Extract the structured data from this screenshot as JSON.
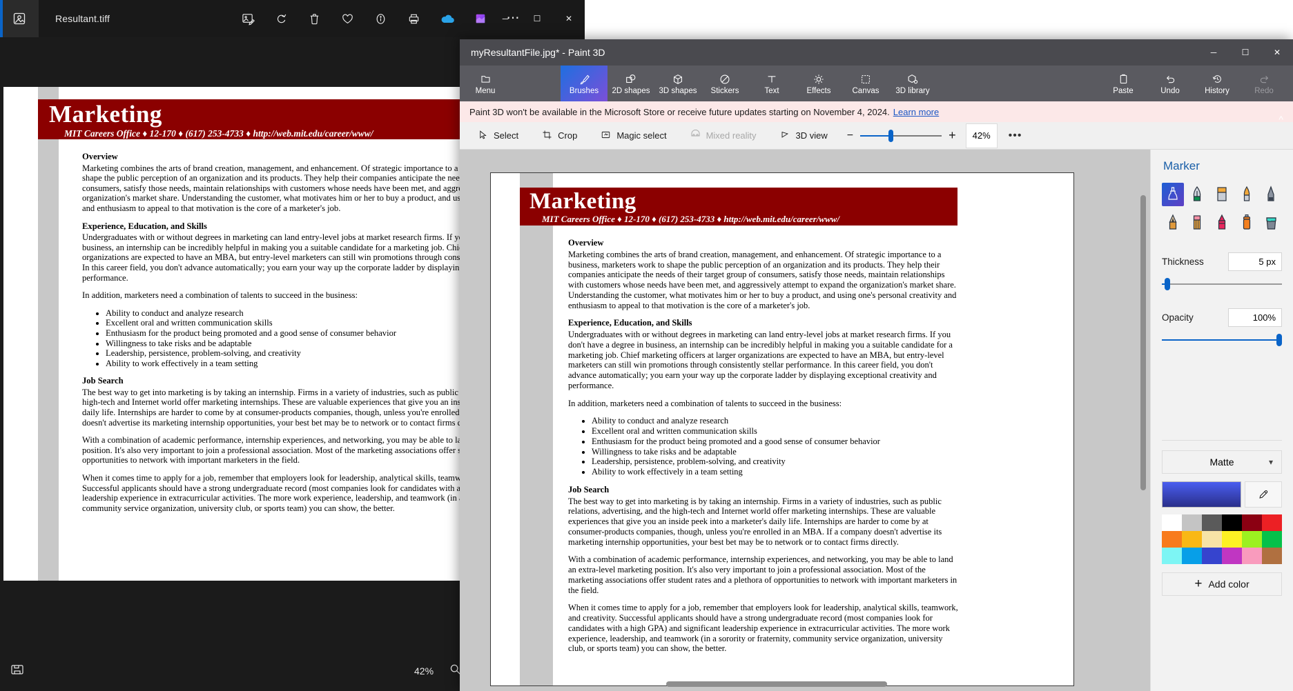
{
  "photos_app": {
    "title": "Resultant.tiff",
    "app_icon": "photos-icon",
    "toolbar": [
      {
        "name": "edit-image-icon",
        "label": "Edit image"
      },
      {
        "name": "rotate-icon",
        "label": "Rotate"
      },
      {
        "name": "delete-icon",
        "label": "Delete"
      },
      {
        "name": "favorite-heart-icon",
        "label": "Add to favorites"
      },
      {
        "name": "info-icon",
        "label": "File info"
      },
      {
        "name": "print-icon",
        "label": "Print"
      },
      {
        "name": "onedrive-icon",
        "label": "OneDrive"
      },
      {
        "name": "designer-icon",
        "label": "Designer"
      },
      {
        "name": "more-options-icon",
        "label": "See more"
      }
    ],
    "window_buttons": {
      "minimize": "─",
      "maximize": "☐",
      "close": "✕"
    },
    "zoom_level": "42%",
    "magnifier_icon": "magnifier-icon",
    "save_icon": "save-icon"
  },
  "paint3d": {
    "title": "myResultantFile.jpg* - Paint 3D",
    "window_buttons": {
      "minimize": "─",
      "maximize": "☐",
      "close": "✕"
    },
    "collapse_icon": "chevron-up-icon",
    "ribbon": {
      "menu": {
        "label": "Menu",
        "icon": "folder-icon"
      },
      "items": [
        {
          "label": "Brushes",
          "icon": "brush-icon",
          "selected": true
        },
        {
          "label": "2D shapes",
          "icon": "2d-shapes-icon",
          "selected": false
        },
        {
          "label": "3D shapes",
          "icon": "3d-shapes-icon",
          "selected": false
        },
        {
          "label": "Stickers",
          "icon": "stickers-icon",
          "selected": false
        },
        {
          "label": "Text",
          "icon": "text-icon",
          "selected": false
        },
        {
          "label": "Effects",
          "icon": "effects-icon",
          "selected": false
        },
        {
          "label": "Canvas",
          "icon": "canvas-icon",
          "selected": false
        },
        {
          "label": "3D library",
          "icon": "3d-library-icon",
          "selected": false
        }
      ],
      "right_items": [
        {
          "label": "Paste",
          "icon": "paste-icon",
          "disabled": false
        },
        {
          "label": "Undo",
          "icon": "undo-icon",
          "disabled": false
        },
        {
          "label": "History",
          "icon": "history-icon",
          "disabled": false
        },
        {
          "label": "Redo",
          "icon": "redo-icon",
          "disabled": true
        }
      ]
    },
    "notice": {
      "text": "Paint 3D won't be available in the Microsoft Store or receive future updates starting on November 4, 2024.",
      "link": "Learn more"
    },
    "subbar": {
      "items": [
        {
          "label": "Select",
          "icon": "cursor-select-icon",
          "disabled": false
        },
        {
          "label": "Crop",
          "icon": "crop-icon",
          "disabled": false
        },
        {
          "label": "Magic select",
          "icon": "magic-select-icon",
          "disabled": false
        },
        {
          "label": "Mixed reality",
          "icon": "mixed-reality-icon",
          "disabled": true
        },
        {
          "label": "3D view",
          "icon": "3d-view-icon",
          "disabled": false
        }
      ],
      "zoom_minus": "−",
      "zoom_plus": "+",
      "zoom_level": "42%",
      "more": "•••"
    },
    "panel": {
      "title": "Marker",
      "brushes": [
        {
          "name": "marker-brush",
          "selected": true
        },
        {
          "name": "calligraphy-pen-brush",
          "selected": false
        },
        {
          "name": "oil-brush",
          "selected": false
        },
        {
          "name": "watercolor-brush",
          "selected": false
        },
        {
          "name": "pixel-pen-brush",
          "selected": false
        },
        {
          "name": "pencil-brush",
          "selected": false
        },
        {
          "name": "eraser-brush",
          "selected": false
        },
        {
          "name": "crayon-brush",
          "selected": false
        },
        {
          "name": "spray-can-brush",
          "selected": false
        },
        {
          "name": "fill-bucket-brush",
          "selected": false
        }
      ],
      "thickness": {
        "label": "Thickness",
        "value": "5 px",
        "percent": 4
      },
      "opacity": {
        "label": "Opacity",
        "value": "100%",
        "percent": 100
      },
      "material": {
        "label": "Matte",
        "chevron": "⌄"
      },
      "current_color": "#3c4ae0",
      "eyedropper_icon": "eyedropper-icon",
      "swatches": [
        "#ffffff",
        "#c4c4c4",
        "#5a5a5a",
        "#000000",
        "#8b0012",
        "#ec2024",
        "#f87b1c",
        "#f9b815",
        "#f7e3a6",
        "#fdf024",
        "#9cf020",
        "#05c14a",
        "#7df5f4",
        "#079fe8",
        "#3644ce",
        "#c036c2",
        "#f99bbd",
        "#b07040"
      ],
      "add_color": {
        "label": "Add color",
        "icon": "plus-icon"
      }
    }
  },
  "document": {
    "banner_title": "Marketing",
    "banner_subtitle": "MIT Careers Office ♦ 12-170 ♦ (617) 253-4733 ♦ http://web.mit.edu/career/www/",
    "sections": [
      {
        "heading": "Overview",
        "paragraphs": [
          "Marketing combines the arts of brand creation, management, and enhancement.  Of strategic importance to a business, marketers work to shape the public perception of an organization and its products.  They help their companies anticipate the needs of their target group of consumers, satisfy those needs, maintain relationships with customers whose needs have been met, and aggressively attempt to expand the organization's market share.  Understanding the customer, what motivates him or her to buy a product, and using one's personal creativity and enthusiasm to appeal to that motivation is the core of a marketer's job."
        ],
        "bullets": []
      },
      {
        "heading": "Experience, Education, and Skills",
        "paragraphs": [
          "Undergraduates with or without degrees in marketing can land entry-level jobs at market research firms.  If you don't have a degree in business, an internship can be incredibly helpful in making you a suitable candidate for a marketing job.  Chief marketing officers at larger organizations are expected to have an MBA, but entry-level marketers can still win promotions through consistently stellar performance.  In this career field, you don't advance automatically; you earn your way up the corporate ladder by displaying exceptional creativity and performance.",
          "In addition, marketers need a combination of talents to succeed in the business:"
        ],
        "bullets": [
          "Ability to conduct and analyze research",
          "Excellent oral and written communication skills",
          "Enthusiasm for the product being promoted and a good sense of consumer behavior",
          "Willingness to take risks and be adaptable",
          "Leadership, persistence, problem-solving, and creativity",
          "Ability to work effectively in a team setting"
        ]
      },
      {
        "heading": "Job Search",
        "paragraphs": [
          "The best way to get into marketing is by taking an internship.  Firms in a variety of industries, such as public relations, advertising, and the high-tech and Internet world offer marketing internships.  These are valuable experiences that give you an inside peek into a marketer's daily life.  Internships are harder to come by at consumer-products companies, though, unless you're enrolled in an MBA.  If a company doesn't advertise its marketing internship opportunities, your best bet may be to network or to contact firms directly.",
          "With a combination of academic performance, internship experiences, and networking, you may be able to land an extra-level marketing position.  It's also very important to join a professional association.  Most of the marketing associations offer student rates and a plethora of opportunities to network with important marketers in the field.",
          "When it comes time to apply for a job, remember that employers look for leadership, analytical skills, teamwork, and creativity.  Successful applicants should have a strong undergraduate record (most companies look for candidates with a high GPA) and significant leadership experience in extracurricular activities.  The more work experience, leadership, and teamwork (in a sorority or fraternity, community service organization, university club, or sports team) you can show, the better."
        ],
        "bullets": []
      }
    ]
  }
}
